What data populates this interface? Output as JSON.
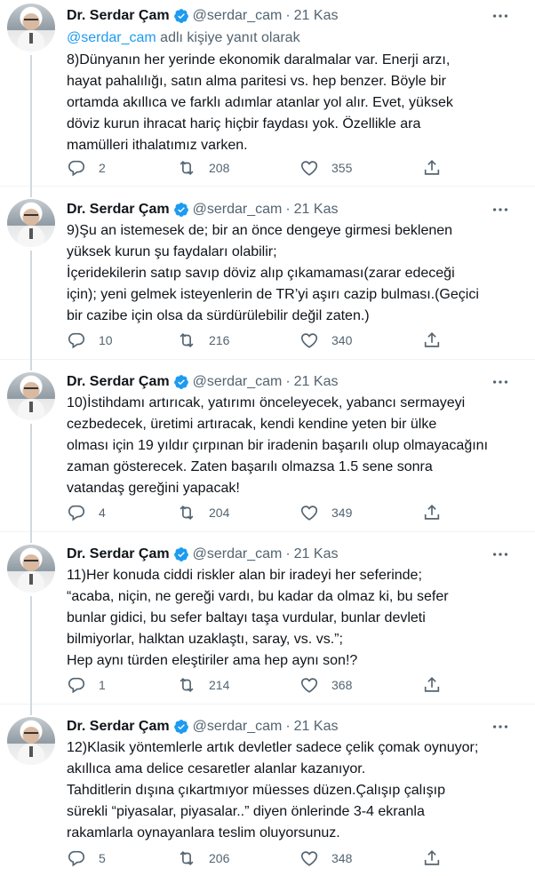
{
  "tweets": [
    {
      "name": "Dr. Serdar Çam",
      "handle": "@serdar_cam",
      "date": "21 Kas",
      "reply_to_prefix": "@serdar_cam",
      "reply_to_suffix": "adlı kişiye yanıt olarak",
      "text": "8)Dünyanın her yerinde ekonomik daralmalar var. Enerji arzı,\nhayat pahalılığı, satın alma paritesi vs. hep benzer. Böyle bir\nortamda akıllıca ve farklı adımlar atanlar yol alır. Evet, yüksek\ndöviz kurun ihracat hariç hiçbir faydası yok. Özellikle ara\nmamülleri ithalatımız varken.",
      "replies": "2",
      "retweets": "208",
      "likes": "355"
    },
    {
      "name": "Dr. Serdar Çam",
      "handle": "@serdar_cam",
      "date": "21 Kas",
      "text": "9)Şu an istemesek de; bir an önce dengeye girmesi beklenen\nyüksek kurun şu faydaları olabilir;\nİçeridekilerin satıp savıp döviz alıp çıkamaması(zarar edeceği\niçin); yeni gelmek isteyenlerin de TR’yi aşırı cazip bulması.(Geçici\nbir cazibe için olsa da sürdürülebilir değil zaten.)",
      "replies": "10",
      "retweets": "216",
      "likes": "340"
    },
    {
      "name": "Dr. Serdar Çam",
      "handle": "@serdar_cam",
      "date": "21 Kas",
      "text": "10)İstihdamı artırıcak, yatırımı önceleyecek, yabancı sermayeyi\ncezbedecek, üretimi artıracak, kendi kendine yeten bir ülke\nolması için 19 yıldır çırpınan bir iradenin başarılı olup olmayacağını\nzaman gösterecek. Zaten başarılı olmazsa 1.5 sene sonra\nvatandaş gereğini yapacak!",
      "replies": "4",
      "retweets": "204",
      "likes": "349"
    },
    {
      "name": "Dr. Serdar Çam",
      "handle": "@serdar_cam",
      "date": "21 Kas",
      "text": "11)Her konuda ciddi riskler alan bir iradeyi her seferinde;\n“acaba, niçin, ne gereği vardı, bu kadar da olmaz ki, bu sefer\nbunlar gidici, bu sefer baltayı taşa vurdular, bunlar devleti\nbilmiyorlar, halktan uzaklaştı, saray, vs. vs.”;\nHep aynı türden eleştiriler ama hep aynı son!?",
      "replies": "1",
      "retweets": "214",
      "likes": "368"
    },
    {
      "name": "Dr. Serdar Çam",
      "handle": "@serdar_cam",
      "date": "21 Kas",
      "text": "12)Klasik yöntemlerle artık devletler sadece çelik çomak oynuyor;\nakıllıca ama delice cesaretler alanlar kazanıyor.\nTahditlerin dışına çıkartmıyor müesses düzen.Çalışıp çalışıp\nsürekli “piyasalar, piyasalar..” diyen önlerinde 3-4 ekranla\nrakamlarla oynayanlara teslim oluyorsunuz.",
      "replies": "5",
      "retweets": "206",
      "likes": "348"
    }
  ],
  "icons": {
    "verified": "verified-badge-icon",
    "more": "more-dots-icon",
    "reply": "reply-bubble-icon",
    "retweet": "retweet-icon",
    "like": "heart-icon",
    "share": "share-icon"
  },
  "colors": {
    "text": "#0f1419",
    "secondary": "#536471",
    "link": "#1d9bf0",
    "thread_line": "#cfd9de"
  }
}
